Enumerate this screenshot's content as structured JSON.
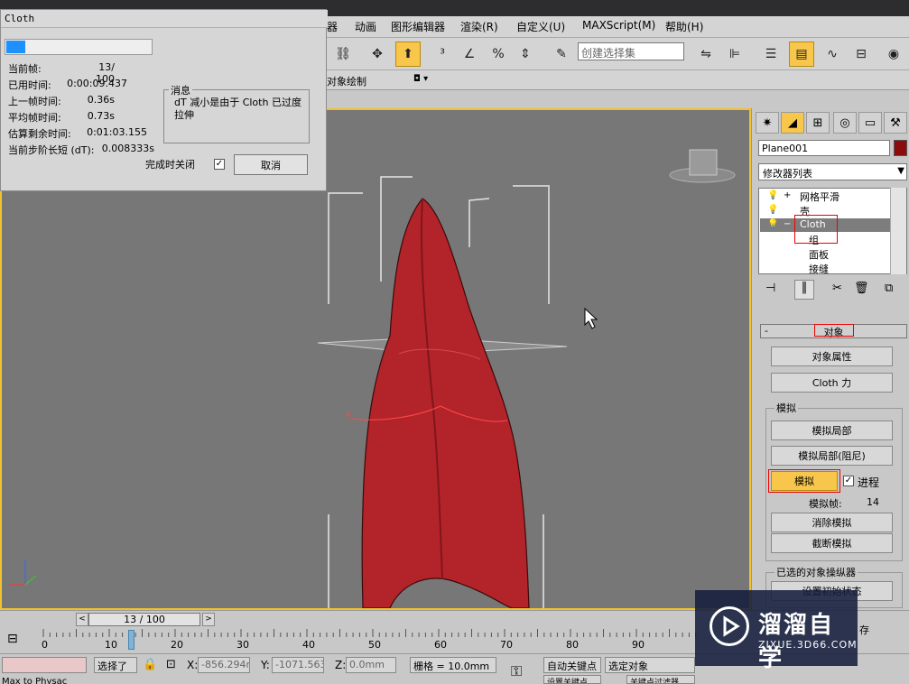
{
  "menu": {
    "items": [
      "器",
      "动画",
      "图形编辑器",
      "渲染(R)",
      "自定义(U)",
      "MAXScript(M)",
      "帮助(H)"
    ]
  },
  "toolbar": {
    "selection_set_placeholder": "创建选择集",
    "paint_label": "对象绘制"
  },
  "dialog": {
    "title": "Cloth",
    "progress_fraction": 0.13,
    "stats": [
      {
        "label": "当前帧:",
        "value": "13/  100"
      },
      {
        "label": "已用时间:",
        "value": "0:00:09.437"
      },
      {
        "label": "上一帧时间:",
        "value": "0.36s"
      },
      {
        "label": "平均帧时间:",
        "value": "0.73s"
      },
      {
        "label": "估算剩余时间:",
        "value": "0:01:03.155"
      },
      {
        "label": "当前步阶长短 (dT):",
        "value": "0.008333s"
      }
    ],
    "message_title": "消息",
    "message_text": "dT 减小是由于 Cloth 已过度拉伸",
    "close_when_done_label": "完成时关闭",
    "close_when_done_checked": "✓",
    "cancel_label": "取消"
  },
  "command_panel": {
    "object_name": "Plane001",
    "object_color": "#8b0c0c",
    "modifier_list_label": "修改器列表",
    "modifier_stack": [
      {
        "label": "网格平滑",
        "toggle": "+"
      },
      {
        "label": "壳",
        "toggle": ""
      },
      {
        "label": "Cloth",
        "toggle": "−"
      },
      {
        "label": "组",
        "toggle": ""
      },
      {
        "label": "面板",
        "toggle": ""
      },
      {
        "label": "接缝",
        "toggle": ""
      }
    ],
    "rollout_collapse": "-",
    "rollout_title": "对象",
    "object_properties_btn": "对象属性",
    "cloth_forces_btn": "Cloth 力",
    "simulation_group": "模拟",
    "simulate_local_btn": "模拟局部",
    "simulate_local_damped_btn": "模拟局部(阻尼)",
    "simulate_btn": "模拟",
    "progress_check_label": "进程",
    "progress_checked": "✓",
    "sim_frame_label": "模拟帧:",
    "sim_frame_value": "14",
    "erase_sim_btn": "消除模拟",
    "truncate_sim_btn": "截断模拟",
    "selected_group": "已选的对象操纵器",
    "set_initial_btn": "设置初始状态",
    "save_partial": "存"
  },
  "timeline": {
    "current": "13 / 100",
    "ticks": [
      "0",
      "10",
      "20",
      "30",
      "40",
      "50",
      "60",
      "70",
      "80",
      "90"
    ],
    "prev_arrow": "<",
    "next_arrow": ">"
  },
  "statusbar": {
    "selected_label": "选择了",
    "x_label": "X:",
    "x_value": "-856.294m",
    "y_label": "Y:",
    "y_value": "-1071.563r",
    "z_label": "Z:",
    "z_value": "0.0mm",
    "grid_label": "栅格 = 10.0mm",
    "auto_key_label": "自动关键点",
    "selected_object": "选定对象",
    "set_key_label": "设置关键点",
    "key_filter_label": "关键点过滤器",
    "bottom_left_text": "Max to Physac"
  },
  "watermark": {
    "title": "溜溜自学",
    "url": "ZIXUE.3D66.COM"
  },
  "colors": {
    "accent": "#f7c64a",
    "viewport_bg": "#777777",
    "cloth_red": "#b3242a"
  }
}
